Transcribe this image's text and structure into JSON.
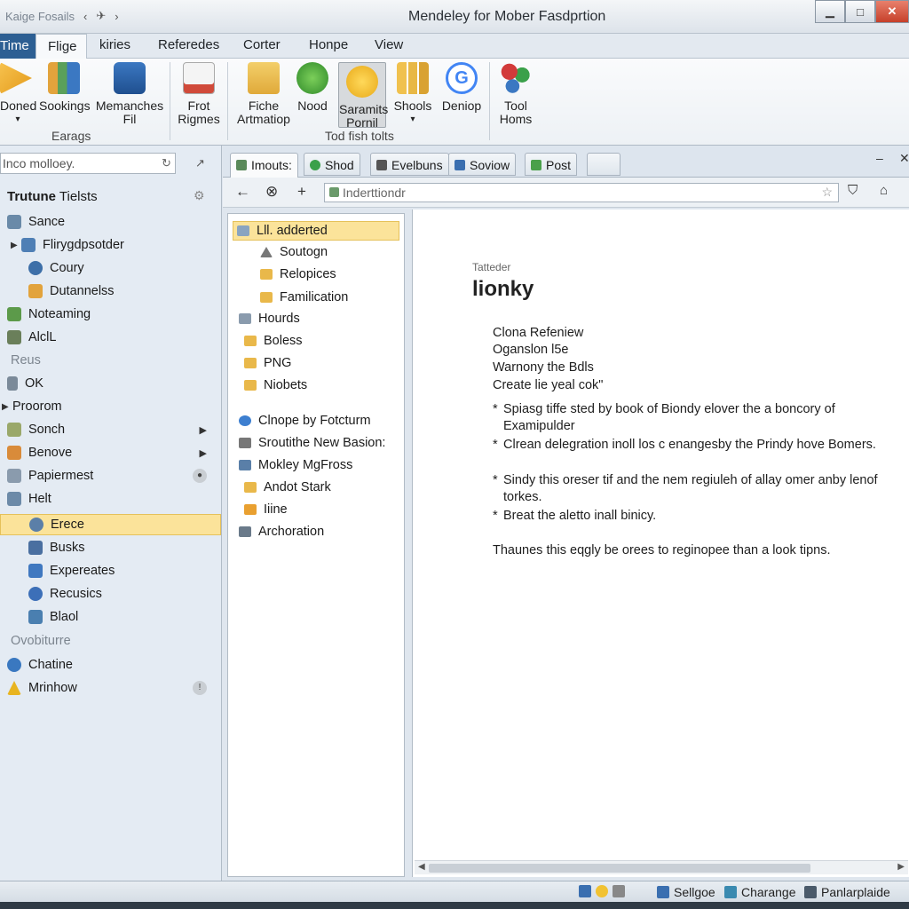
{
  "window": {
    "title": "Mendeley for Mober Fasdprtion",
    "qat_label": "Kaige Fosails",
    "minimize": "▁",
    "maximize": "□",
    "close": "✕"
  },
  "menu": {
    "file": "Time",
    "tabs": [
      "Flige",
      "kiries",
      "Referedes",
      "Corter",
      "Honpe",
      "View"
    ]
  },
  "ribbon": {
    "buttons": [
      {
        "label1": "Doned",
        "label2": "▾",
        "icon": "arrow-icon",
        "color": "#f2b233"
      },
      {
        "label1": "Sookings",
        "label2": "",
        "icon": "books-icon",
        "color": "#5aa05a"
      },
      {
        "label1": "Memanches",
        "label2": "Fil",
        "icon": "monitor-icon",
        "color": "#3b78c2"
      },
      {
        "label1": "Frot",
        "label2": "Rigmes",
        "icon": "document-icon",
        "color": "#d9d9d9"
      },
      {
        "label1": "Fiche",
        "label2": "Artmatiop",
        "icon": "folder-icon",
        "color": "#e9b84a"
      },
      {
        "label1": "Nood",
        "label2": "",
        "icon": "leaf-icon",
        "color": "#4ca83c"
      },
      {
        "label1": "Saramits",
        "label2": "Pornil",
        "icon": "smiley-icon",
        "color": "#f1c232"
      },
      {
        "label1": "Shools",
        "label2": "▾",
        "icon": "chart-icon",
        "color": "#e8b845"
      },
      {
        "label1": "Deniop",
        "label2": "",
        "icon": "google-icon",
        "color": "#4285f4"
      },
      {
        "label1": "Tool",
        "label2": "Homs",
        "icon": "network-icon",
        "color": "#d23a3a"
      }
    ],
    "groups": [
      "Earags",
      "Tod fish tolts"
    ]
  },
  "sidebar": {
    "search_placeholder": "Inco molloey.",
    "library_title_bold": "Trutune",
    "library_title_rest": " Tielsts",
    "items": [
      {
        "label": "Sance",
        "color": "#6a8aa8"
      },
      {
        "label": "Flirygdpsotder",
        "color": "#4f7fb5"
      },
      {
        "label": "Coury",
        "color": "#3d6fa8"
      },
      {
        "label": "Dutannelss",
        "color": "#e2a33c"
      },
      {
        "label": "Noteaming",
        "color": "#5c9a4a"
      },
      {
        "label": "AlclL",
        "color": "#6a7f5a"
      },
      {
        "label": "Reus",
        "color": ""
      },
      {
        "label": "OK",
        "color": "#7b8a99"
      },
      {
        "label": "Proorom",
        "color": ""
      },
      {
        "label": "Sonch",
        "color": "#9aa86a"
      },
      {
        "label": "Benove",
        "color": "#d98b3a"
      },
      {
        "label": "Papiermest",
        "color": "#8a9bad"
      },
      {
        "label": "Helt",
        "color": "#6c8aa8"
      },
      {
        "label": "Erece",
        "color": "#5b7fa8"
      },
      {
        "label": "Busks",
        "color": "#4a6fa0"
      },
      {
        "label": "Expereates",
        "color": "#3f78c0"
      },
      {
        "label": "Recusics",
        "color": "#3c6fb8"
      },
      {
        "label": "Blaol",
        "color": "#4a7fb0"
      },
      {
        "label": "Ovobiturre",
        "color": ""
      },
      {
        "label": "Chatine",
        "color": "#3a78c0"
      },
      {
        "label": "Mrinhow",
        "color": "#e8b420"
      }
    ]
  },
  "doc_tabs": [
    {
      "label": "Imouts:",
      "color": "#5a8a5a"
    },
    {
      "label": "Shod",
      "color": "#3aa04a"
    },
    {
      "label": "Evelbuns",
      "color": "#555555"
    },
    {
      "label": "Soviow",
      "color": "#3b6fb0"
    },
    {
      "label": "Post",
      "color": "#4aa04a"
    }
  ],
  "navbar": {
    "url": "Inderttiondr"
  },
  "folders": [
    {
      "label": "Lll. adderted",
      "color": "#8aa4c0"
    },
    {
      "label": "Soutogn",
      "color": "#777777"
    },
    {
      "label": "Relopices",
      "color": "#e9b84a"
    },
    {
      "label": "Familication",
      "color": "#e9b84a"
    },
    {
      "label": "Hourds",
      "color": "#8a9bad"
    },
    {
      "label": "Boless",
      "color": "#e9b84a"
    },
    {
      "label": "PNG",
      "color": "#e9b84a"
    },
    {
      "label": "Niobets",
      "color": "#e9b84a"
    },
    {
      "label": "Clnope by Fotcturm",
      "color": "#3d7fd0"
    },
    {
      "label": "Sroutithe New Basion:",
      "color": "#777777"
    },
    {
      "label": "Mokley MgFross",
      "color": "#5a7fa8"
    },
    {
      "label": "Andot Stark",
      "color": "#e9b84a"
    },
    {
      "label": "Iiine",
      "color": "#e9a030"
    },
    {
      "label": "Archoration",
      "color": "#6a7a8a"
    }
  ],
  "document": {
    "subtitle": "Tatteder",
    "title": "lionky",
    "lines": [
      "Clona Refeniew",
      "Oganslon l5e",
      "Warnony the Bdls",
      "Create lie yeal cok\""
    ],
    "bullets": [
      "Spiasg tiffe sted by book of Biondy elover the a boncory of Examipulder",
      "Clrean delegration inoll los c enangesby the Prindy hove Bomers.",
      "Sindy this oreser tif and the nem regiuleh of allay omer anby lenof torkes.",
      "Breat the aletto inall binicy."
    ],
    "footer": "Thaunes this eqgly be orees to reginopee than a look tipns."
  },
  "status": [
    {
      "label": "Sellgoe",
      "color": "#3a6fb0"
    },
    {
      "label": "Charange",
      "color": "#3a8ab0"
    },
    {
      "label": "Panlarplaide",
      "color": "#4a5a6a"
    }
  ]
}
